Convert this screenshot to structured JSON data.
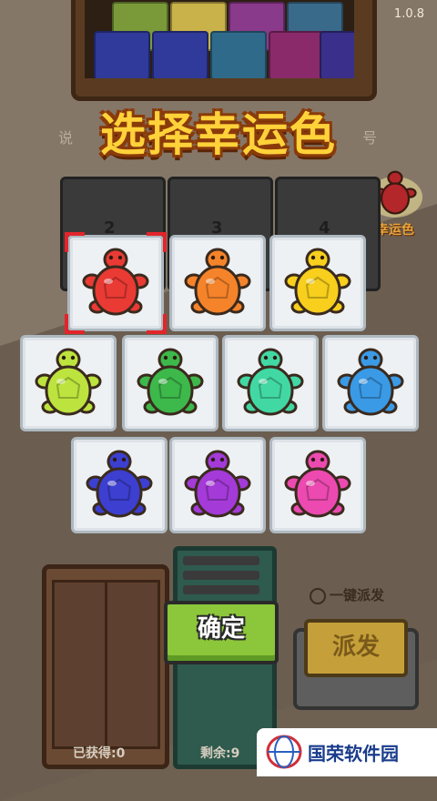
{
  "version": "1.0.8",
  "title": "选择幸运色",
  "title_ghost_left": "说",
  "title_ghost_right": "号",
  "lucky": {
    "label": "幸运色",
    "color": "#b3262a"
  },
  "slot_numbers": [
    "2",
    "3",
    "4"
  ],
  "turtles": [
    {
      "name": "red",
      "color": "#ea3a34",
      "selected": true
    },
    {
      "name": "orange",
      "color": "#f5832a",
      "selected": false
    },
    {
      "name": "yellow",
      "color": "#f7cf1c",
      "selected": false
    },
    {
      "name": "lime",
      "color": "#bde33e",
      "selected": false
    },
    {
      "name": "green",
      "color": "#3db84a",
      "selected": false
    },
    {
      "name": "teal",
      "color": "#42d8a4",
      "selected": false
    },
    {
      "name": "blue",
      "color": "#3a9ae6",
      "selected": false
    },
    {
      "name": "indigo",
      "color": "#3c3fd0",
      "selected": false
    },
    {
      "name": "purple",
      "color": "#a43ad8",
      "selected": false
    },
    {
      "name": "pink",
      "color": "#ec4ab0",
      "selected": false
    }
  ],
  "buttons": {
    "confirm": "确定",
    "deliver": "派发",
    "auto_deliver": "一键派发"
  },
  "counters": {
    "obtained": "已获得:0",
    "remaining": "剩余:9"
  },
  "watermark": "国荣软件园",
  "colors": {
    "selection": "#e3242b",
    "confirm_green": "#8cc63a",
    "title_yellow": "#ffd23a"
  }
}
